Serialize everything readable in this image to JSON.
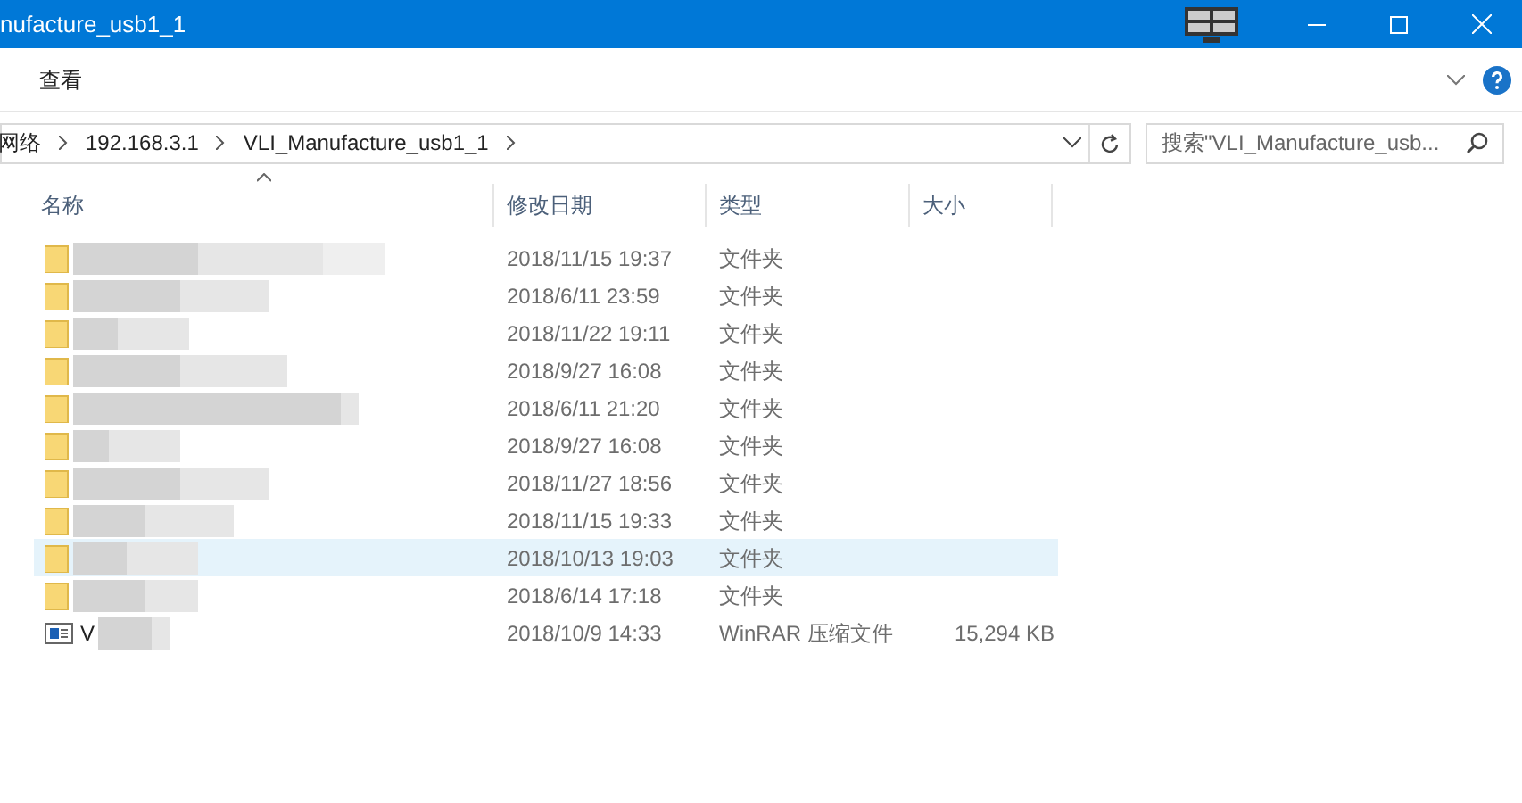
{
  "window": {
    "title": "nufacture_usb1_1"
  },
  "ribbon": {
    "tabs": [
      {
        "label": "查看",
        "selected": false
      }
    ]
  },
  "address": {
    "crumbs": [
      "网络",
      "192.168.3.1",
      "VLI_Manufacture_usb1_1"
    ]
  },
  "search": {
    "placeholder": "搜索\"VLI_Manufacture_usb..."
  },
  "columns": [
    "名称",
    "修改日期",
    "类型",
    "大小"
  ],
  "rows": [
    {
      "kind": "folder",
      "date": "2018/11/15 19:37",
      "type": "文件夹",
      "highlighted": false
    },
    {
      "kind": "folder",
      "date": "2018/6/11 23:59",
      "type": "文件夹",
      "highlighted": false
    },
    {
      "kind": "folder",
      "date": "2018/11/22 19:11",
      "type": "文件夹",
      "highlighted": false
    },
    {
      "kind": "folder",
      "date": "2018/9/27 16:08",
      "type": "文件夹",
      "highlighted": false
    },
    {
      "kind": "folder",
      "date": "2018/6/11 21:20",
      "type": "文件夹",
      "highlighted": false
    },
    {
      "kind": "folder",
      "date": "2018/9/27 16:08",
      "type": "文件夹",
      "highlighted": false
    },
    {
      "kind": "folder",
      "date": "2018/11/27 18:56",
      "type": "文件夹",
      "highlighted": false
    },
    {
      "kind": "folder",
      "date": "2018/11/15 19:33",
      "type": "文件夹",
      "highlighted": false
    },
    {
      "kind": "folder",
      "date": "2018/10/13 19:03",
      "type": "文件夹",
      "highlighted": true
    },
    {
      "kind": "folder",
      "date": "2018/6/14 17:18",
      "type": "文件夹",
      "highlighted": false
    },
    {
      "kind": "archive",
      "name": "V",
      "date": "2018/10/9 14:33",
      "type": "WinRAR 压缩文件",
      "size": "15,294 KB",
      "highlighted": false
    }
  ]
}
